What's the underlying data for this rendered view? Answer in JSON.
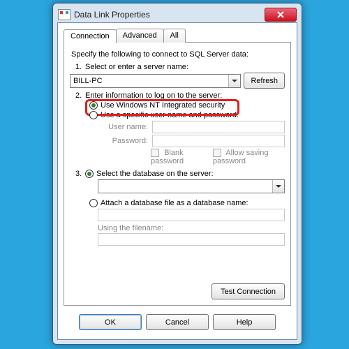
{
  "window": {
    "title": "Data Link Properties",
    "close_glyph": "×"
  },
  "tabs": {
    "connection": "Connection",
    "advanced": "Advanced",
    "all": "All"
  },
  "intro": "Specify the following to connect to SQL Server data:",
  "step1": {
    "num": "1.",
    "label": "Select or enter a server name:",
    "server_value": "BILL-PC",
    "refresh": "Refresh"
  },
  "step2": {
    "num": "2.",
    "label": "Enter information to log on to the server:",
    "opt_integrated": "Use Windows NT Integrated security",
    "opt_specific": "Use a specific user name and password:",
    "user_label": "User name:",
    "pass_label": "Password:",
    "blank_pw": "Blank password",
    "allow_save": "Allow saving password"
  },
  "step3": {
    "num": "3.",
    "opt_selectdb": "Select the database on the server:",
    "opt_attach": "Attach a database file as a database name:",
    "using_file": "Using the filename:"
  },
  "test_btn": "Test Connection",
  "buttons": {
    "ok": "OK",
    "cancel": "Cancel",
    "help": "Help"
  }
}
